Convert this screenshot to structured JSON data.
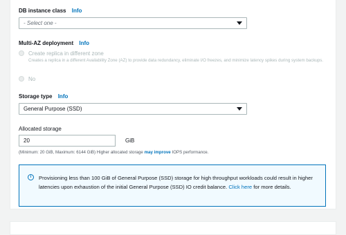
{
  "db_instance_class": {
    "label": "DB instance class",
    "info": "Info",
    "select_value": "- Select one -"
  },
  "multi_az": {
    "label": "Multi-AZ deployment",
    "info": "Info",
    "option_replica": {
      "label": "Create replica in different zone",
      "description": "Creates a replica in a different Availability Zone (AZ) to provide data redundancy, eliminate I/O freezes, and minimize latency spikes during system backups."
    },
    "option_no": {
      "label": "No"
    }
  },
  "storage_type": {
    "label": "Storage type",
    "info": "Info",
    "select_value": "General Purpose (SSD)"
  },
  "allocated_storage": {
    "label": "Allocated storage",
    "value": "20",
    "unit": "GiB",
    "hint_prefix": "(Minimum: 20 GiB, Maximum: 6144 GiB) Higher allocated storage ",
    "hint_link": "may improve",
    "hint_suffix": " IOPS performance."
  },
  "alert": {
    "icon": "info-circle-icon",
    "text_main": "Provisioning less than 100 GiB of General Purpose (SSD) storage for high throughput workloads could result in higher latencies upon exhaustion of the initial General Purpose (SSD) IO credit balance. ",
    "link_text": "Click here",
    "text_end": " for more details."
  },
  "colors": {
    "link": "#0073bb",
    "disabled": "#aab7b8",
    "alert_bg": "#f1faff"
  }
}
